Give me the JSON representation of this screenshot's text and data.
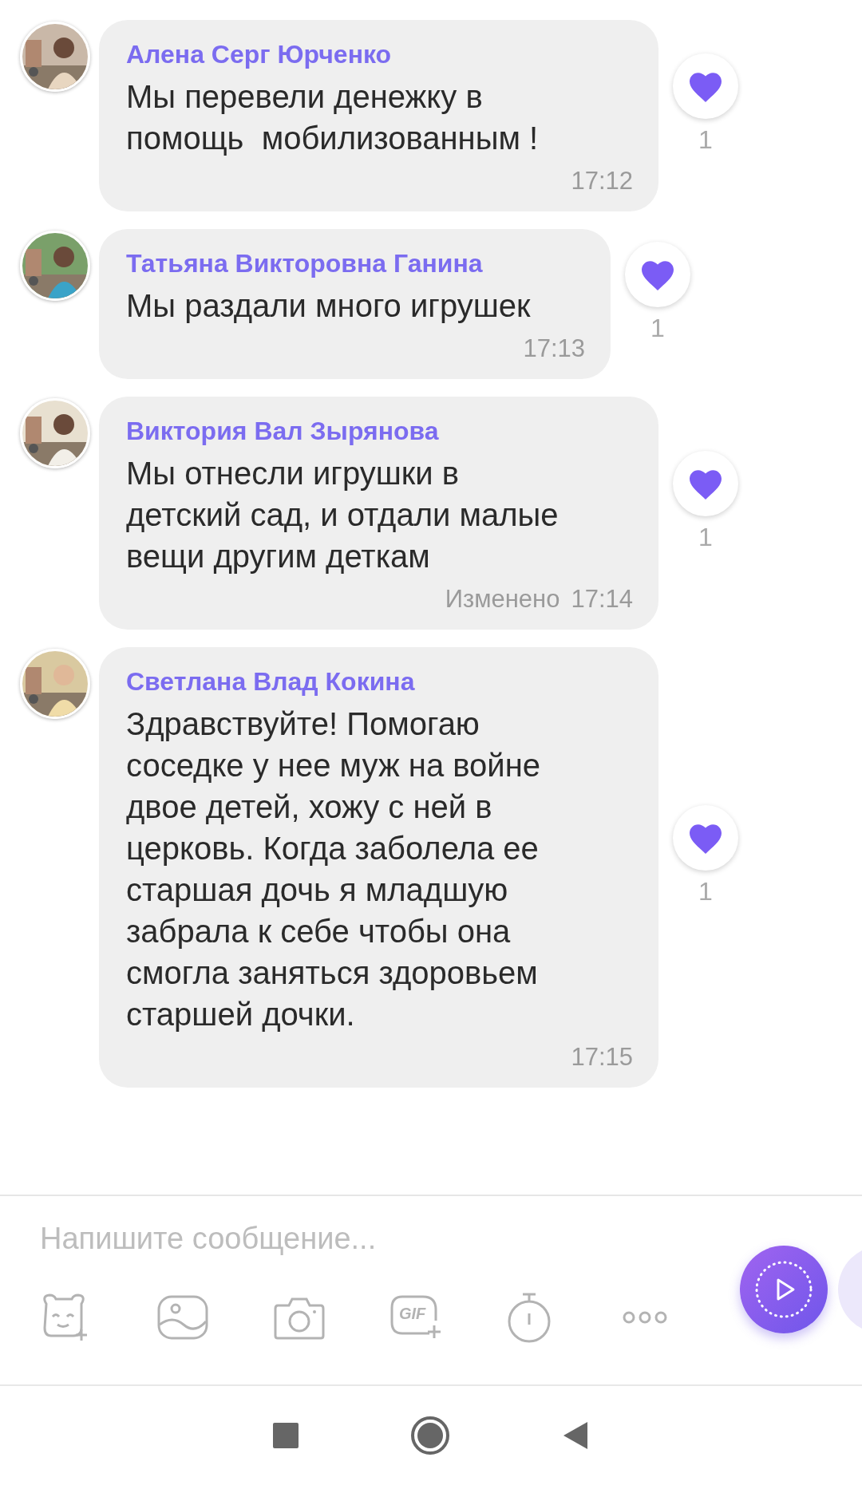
{
  "messages": [
    {
      "author": "Алена Серг Юрченко",
      "text": "Мы перевели денежку в\nпомощь  мобилизованным !",
      "time": "17:12",
      "likes": "1",
      "liked": true
    },
    {
      "author": "Татьяна Викторовна Ганина",
      "text": "Мы раздали много игрушек",
      "time": "17:13",
      "likes": "1",
      "liked": true
    },
    {
      "author": "Виктория Вал Зырянова",
      "text": "Мы отнесли игрушки в\nдетский сад, и отдали малые\nвещи другим деткам",
      "edited": "Изменено",
      "time": "17:14",
      "likes": "1",
      "liked": true
    },
    {
      "author": "Светлана Влад Кокина",
      "text": "Здравствуйте! Помогаю\nсоседке у нее муж на войне\nдвое детей, хожу с ней в\nцерковь. Когда заболела ее\nстаршая дочь я младшую\nзабрала к себе чтобы она\nсмогла заняться здоровьем\nстаршей дочки.",
      "time": "17:15",
      "likes": "1",
      "liked": true
    }
  ],
  "composer": {
    "placeholder": "Напишите сообщение...",
    "tools": [
      {
        "kind": "sticker"
      },
      {
        "kind": "gallery"
      },
      {
        "kind": "camera"
      },
      {
        "kind": "gif",
        "label": "GIF"
      },
      {
        "kind": "timer"
      },
      {
        "kind": "more"
      }
    ]
  }
}
